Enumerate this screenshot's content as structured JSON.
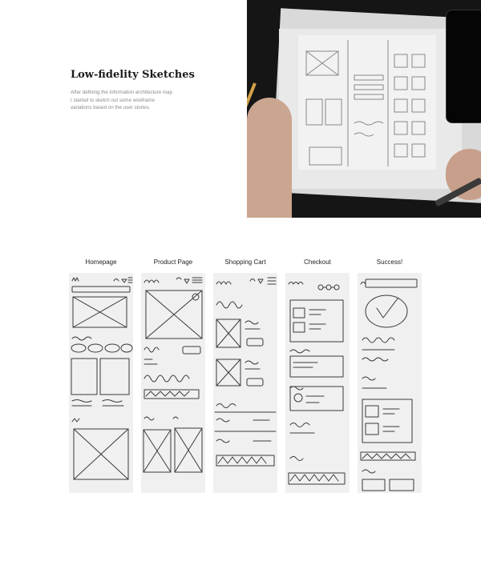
{
  "intro": {
    "title": "Low-fidelity Sketches",
    "description": "After defining the information architecture map I started to sketch out some wireframe variations based on the user stories."
  },
  "photo": {
    "icon": "wireframe-paper-photo"
  },
  "sketches": [
    {
      "label": "Homepage"
    },
    {
      "label": "Product Page"
    },
    {
      "label": "Shopping Cart"
    },
    {
      "label": "Checkout"
    },
    {
      "label": "Success!"
    }
  ]
}
